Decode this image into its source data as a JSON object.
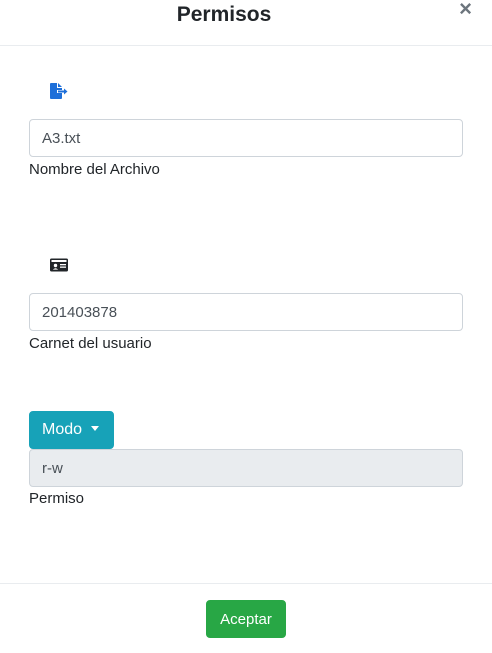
{
  "modal": {
    "title": "Permisos",
    "close_glyph": "×"
  },
  "file_section": {
    "icon": "file-export-icon",
    "value": "A3.txt",
    "label": "Nombre del Archivo"
  },
  "user_section": {
    "icon": "id-card-icon",
    "value": "201403878",
    "label": "Carnet del usuario"
  },
  "mode_section": {
    "dropdown_label": "Modo",
    "value": "r-w",
    "label": "Permiso"
  },
  "footer": {
    "accept_label": "Aceptar"
  },
  "colors": {
    "primary_icon": "#1e6fd9",
    "mode_button": "#17a2b8",
    "accept_button": "#28a745",
    "readonly_bg": "#e9ecef"
  }
}
